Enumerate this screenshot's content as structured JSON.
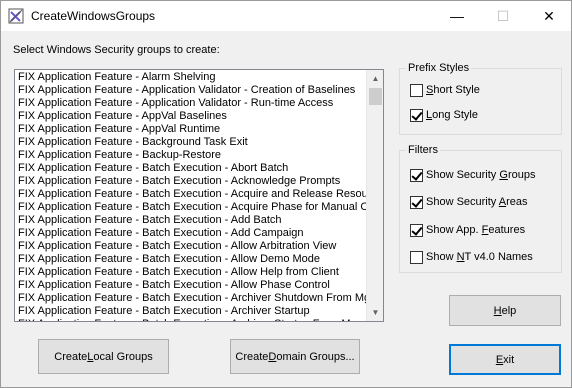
{
  "window": {
    "title": "CreateWindowsGroups",
    "controls": {
      "minimize": "—",
      "maximize": "☐",
      "close": "✕"
    }
  },
  "prompt": "Select Windows Security groups to create:",
  "groups_list": {
    "items": [
      "FIX Application Feature - Alarm Shelving",
      "FIX Application Feature - Application Validator - Creation of Baselines",
      "FIX Application Feature - Application Validator - Run-time Access",
      "FIX Application Feature - AppVal Baselines",
      "FIX Application Feature - AppVal Runtime",
      "FIX Application Feature - Background Task Exit",
      "FIX Application Feature - Backup-Restore",
      "FIX Application Feature - Batch Execution - Abort Batch",
      "FIX Application Feature - Batch Execution - Acknowledge Prompts",
      "FIX Application Feature - Batch Execution - Acquire and Release Resourc",
      "FIX Application Feature - Batch Execution - Acquire Phase for Manual Cor",
      "FIX Application Feature - Batch Execution - Add Batch",
      "FIX Application Feature - Batch Execution - Add Campaign",
      "FIX Application Feature - Batch Execution - Allow Arbitration View",
      "FIX Application Feature - Batch Execution - Allow Demo Mode",
      "FIX Application Feature - Batch Execution - Allow Help from Client",
      "FIX Application Feature - Batch Execution - Allow Phase Control",
      "FIX Application Feature - Batch Execution - Archiver Shutdown From Mgr",
      "FIX Application Feature - Batch Execution - Archiver Startup",
      "FIX Application Feature - Batch Execution - Archiver Startup From Mgr"
    ]
  },
  "prefix_styles": {
    "legend": "Prefix Styles",
    "short": {
      "pre": "",
      "key": "S",
      "post": "hort Style",
      "checked": false
    },
    "long": {
      "pre": "",
      "key": "L",
      "post": "ong Style",
      "checked": true
    }
  },
  "filters": {
    "legend": "Filters",
    "security_groups": {
      "pre": "Show Security ",
      "key": "G",
      "post": "roups",
      "checked": true
    },
    "security_areas": {
      "pre": "Show Security ",
      "key": "A",
      "post": "reas",
      "checked": true
    },
    "app_features": {
      "pre": "Show App. ",
      "key": "F",
      "post": "eatures",
      "checked": true
    },
    "nt_names": {
      "pre": "Show ",
      "key": "N",
      "post": "T v4.0 Names",
      "checked": false
    }
  },
  "buttons": {
    "help": {
      "pre": "",
      "key": "H",
      "post": "elp"
    },
    "exit": {
      "pre": "",
      "key": "E",
      "post": "xit"
    },
    "create_local": {
      "pre": "Create ",
      "key": "L",
      "post": "ocal Groups"
    },
    "create_domain": {
      "pre": "Create ",
      "key": "D",
      "post": "omain Groups..."
    }
  }
}
